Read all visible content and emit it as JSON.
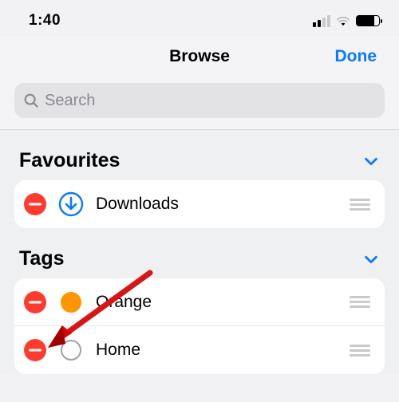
{
  "status": {
    "time": "1:40"
  },
  "nav": {
    "title": "Browse",
    "done": "Done"
  },
  "search": {
    "placeholder": "Search"
  },
  "sections": {
    "favourites": {
      "title": "Favourites",
      "items": [
        {
          "label": "Downloads"
        }
      ]
    },
    "tags": {
      "title": "Tags",
      "items": [
        {
          "label": "Orange",
          "color": "#ff9500"
        },
        {
          "label": "Home"
        }
      ]
    }
  }
}
